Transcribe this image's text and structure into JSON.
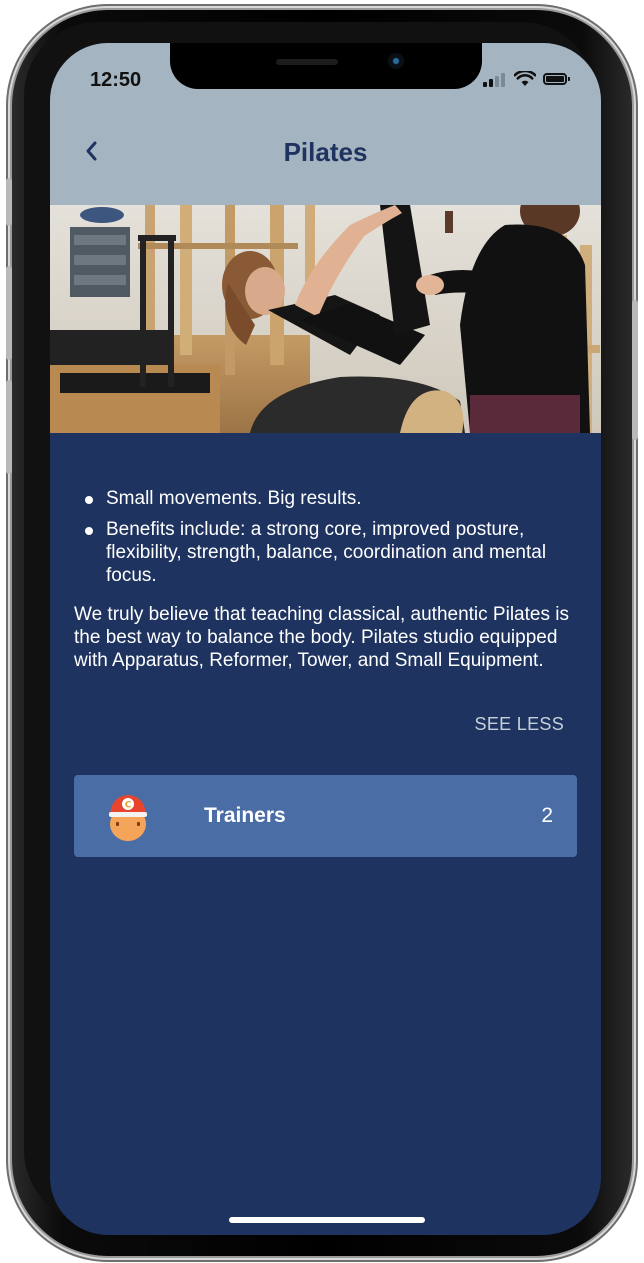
{
  "status_bar": {
    "time": "12:50",
    "icons": [
      "signal-icon",
      "wifi-icon",
      "battery-icon"
    ]
  },
  "header": {
    "back_icon": "chevron-left-icon",
    "title": "Pilates"
  },
  "hero": {
    "image": "pilates-studio-photo"
  },
  "description": {
    "bullets": [
      "Small movements. Big results.",
      "Benefits include: a strong core, improved posture, flexibility, strength, balance, coordination and mental focus."
    ],
    "paragraph": "We truly believe that teaching classical, authentic Pilates is the best way to balance the body. Pilates studio equipped with Apparatus, Reformer, Tower, and Small Equipment.",
    "toggle_label": "SEE LESS"
  },
  "trainers": {
    "icon": "trainer-avatar-icon",
    "label": "Trainers",
    "count": "2"
  },
  "colors": {
    "header_bg": "#a4b4c1",
    "screen_bg": "#1e335f",
    "card_bg": "#4a6da5",
    "title_color": "#1e335f"
  }
}
